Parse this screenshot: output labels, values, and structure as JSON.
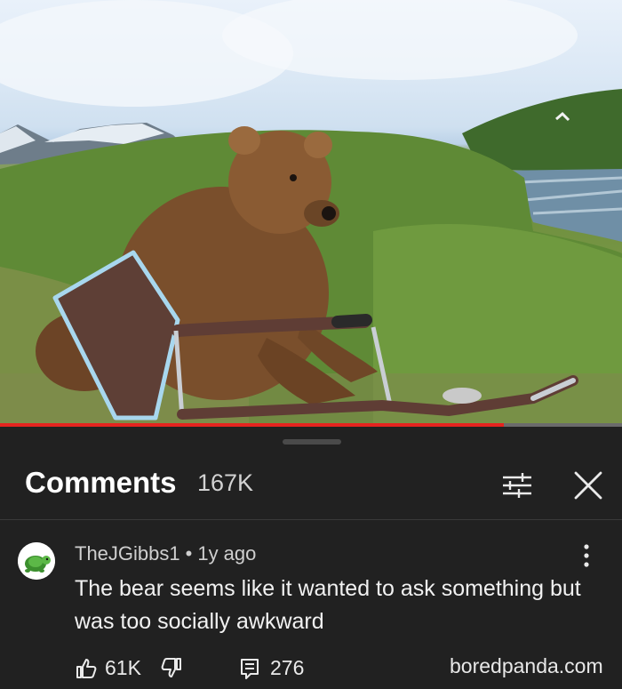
{
  "video": {
    "progress_fraction": 0.81,
    "progress_color": "#e5231f"
  },
  "comments": {
    "title": "Comments",
    "count": "167K",
    "filter_icon": "sort-filter-icon",
    "close_icon": "close-icon"
  },
  "comment": {
    "author": "TheJGibbs1",
    "separator": "•",
    "age": "1y ago",
    "text": "The bear seems like it wanted to ask something but was too socially awkward",
    "likes": "61K",
    "replies": "276",
    "avatar_icon": "turtle-avatar-icon",
    "like_icon": "thumbs-up-icon",
    "dislike_icon": "thumbs-down-icon",
    "reply_icon": "reply-icon",
    "menu_icon": "more-vertical-icon"
  },
  "watermark": "boredpanda.com"
}
